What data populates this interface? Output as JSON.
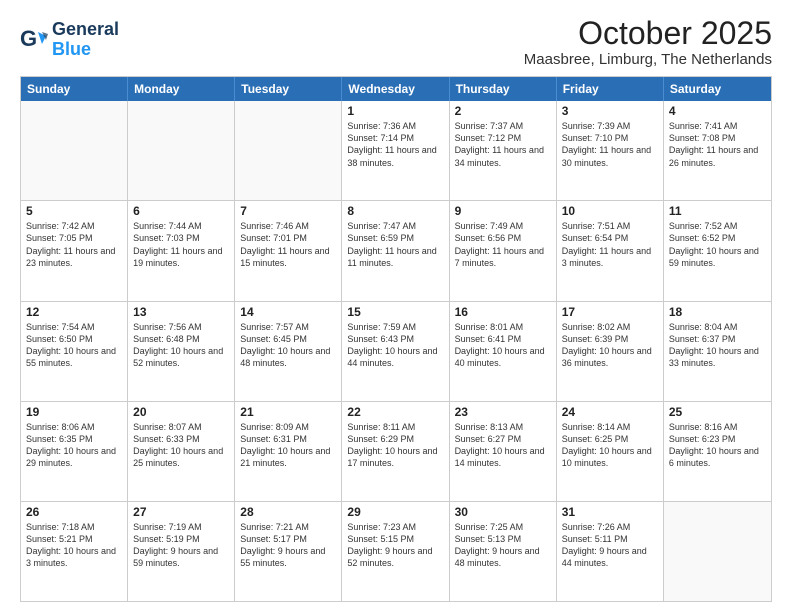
{
  "header": {
    "logo_line1": "General",
    "logo_line2": "Blue",
    "month": "October 2025",
    "location": "Maasbree, Limburg, The Netherlands"
  },
  "weekdays": [
    "Sunday",
    "Monday",
    "Tuesday",
    "Wednesday",
    "Thursday",
    "Friday",
    "Saturday"
  ],
  "weeks": [
    [
      {
        "day": "",
        "info": ""
      },
      {
        "day": "",
        "info": ""
      },
      {
        "day": "",
        "info": ""
      },
      {
        "day": "1",
        "info": "Sunrise: 7:36 AM\nSunset: 7:14 PM\nDaylight: 11 hours\nand 38 minutes."
      },
      {
        "day": "2",
        "info": "Sunrise: 7:37 AM\nSunset: 7:12 PM\nDaylight: 11 hours\nand 34 minutes."
      },
      {
        "day": "3",
        "info": "Sunrise: 7:39 AM\nSunset: 7:10 PM\nDaylight: 11 hours\nand 30 minutes."
      },
      {
        "day": "4",
        "info": "Sunrise: 7:41 AM\nSunset: 7:08 PM\nDaylight: 11 hours\nand 26 minutes."
      }
    ],
    [
      {
        "day": "5",
        "info": "Sunrise: 7:42 AM\nSunset: 7:05 PM\nDaylight: 11 hours\nand 23 minutes."
      },
      {
        "day": "6",
        "info": "Sunrise: 7:44 AM\nSunset: 7:03 PM\nDaylight: 11 hours\nand 19 minutes."
      },
      {
        "day": "7",
        "info": "Sunrise: 7:46 AM\nSunset: 7:01 PM\nDaylight: 11 hours\nand 15 minutes."
      },
      {
        "day": "8",
        "info": "Sunrise: 7:47 AM\nSunset: 6:59 PM\nDaylight: 11 hours\nand 11 minutes."
      },
      {
        "day": "9",
        "info": "Sunrise: 7:49 AM\nSunset: 6:56 PM\nDaylight: 11 hours\nand 7 minutes."
      },
      {
        "day": "10",
        "info": "Sunrise: 7:51 AM\nSunset: 6:54 PM\nDaylight: 11 hours\nand 3 minutes."
      },
      {
        "day": "11",
        "info": "Sunrise: 7:52 AM\nSunset: 6:52 PM\nDaylight: 10 hours\nand 59 minutes."
      }
    ],
    [
      {
        "day": "12",
        "info": "Sunrise: 7:54 AM\nSunset: 6:50 PM\nDaylight: 10 hours\nand 55 minutes."
      },
      {
        "day": "13",
        "info": "Sunrise: 7:56 AM\nSunset: 6:48 PM\nDaylight: 10 hours\nand 52 minutes."
      },
      {
        "day": "14",
        "info": "Sunrise: 7:57 AM\nSunset: 6:45 PM\nDaylight: 10 hours\nand 48 minutes."
      },
      {
        "day": "15",
        "info": "Sunrise: 7:59 AM\nSunset: 6:43 PM\nDaylight: 10 hours\nand 44 minutes."
      },
      {
        "day": "16",
        "info": "Sunrise: 8:01 AM\nSunset: 6:41 PM\nDaylight: 10 hours\nand 40 minutes."
      },
      {
        "day": "17",
        "info": "Sunrise: 8:02 AM\nSunset: 6:39 PM\nDaylight: 10 hours\nand 36 minutes."
      },
      {
        "day": "18",
        "info": "Sunrise: 8:04 AM\nSunset: 6:37 PM\nDaylight: 10 hours\nand 33 minutes."
      }
    ],
    [
      {
        "day": "19",
        "info": "Sunrise: 8:06 AM\nSunset: 6:35 PM\nDaylight: 10 hours\nand 29 minutes."
      },
      {
        "day": "20",
        "info": "Sunrise: 8:07 AM\nSunset: 6:33 PM\nDaylight: 10 hours\nand 25 minutes."
      },
      {
        "day": "21",
        "info": "Sunrise: 8:09 AM\nSunset: 6:31 PM\nDaylight: 10 hours\nand 21 minutes."
      },
      {
        "day": "22",
        "info": "Sunrise: 8:11 AM\nSunset: 6:29 PM\nDaylight: 10 hours\nand 17 minutes."
      },
      {
        "day": "23",
        "info": "Sunrise: 8:13 AM\nSunset: 6:27 PM\nDaylight: 10 hours\nand 14 minutes."
      },
      {
        "day": "24",
        "info": "Sunrise: 8:14 AM\nSunset: 6:25 PM\nDaylight: 10 hours\nand 10 minutes."
      },
      {
        "day": "25",
        "info": "Sunrise: 8:16 AM\nSunset: 6:23 PM\nDaylight: 10 hours\nand 6 minutes."
      }
    ],
    [
      {
        "day": "26",
        "info": "Sunrise: 7:18 AM\nSunset: 5:21 PM\nDaylight: 10 hours\nand 3 minutes."
      },
      {
        "day": "27",
        "info": "Sunrise: 7:19 AM\nSunset: 5:19 PM\nDaylight: 9 hours\nand 59 minutes."
      },
      {
        "day": "28",
        "info": "Sunrise: 7:21 AM\nSunset: 5:17 PM\nDaylight: 9 hours\nand 55 minutes."
      },
      {
        "day": "29",
        "info": "Sunrise: 7:23 AM\nSunset: 5:15 PM\nDaylight: 9 hours\nand 52 minutes."
      },
      {
        "day": "30",
        "info": "Sunrise: 7:25 AM\nSunset: 5:13 PM\nDaylight: 9 hours\nand 48 minutes."
      },
      {
        "day": "31",
        "info": "Sunrise: 7:26 AM\nSunset: 5:11 PM\nDaylight: 9 hours\nand 44 minutes."
      },
      {
        "day": "",
        "info": ""
      }
    ]
  ]
}
